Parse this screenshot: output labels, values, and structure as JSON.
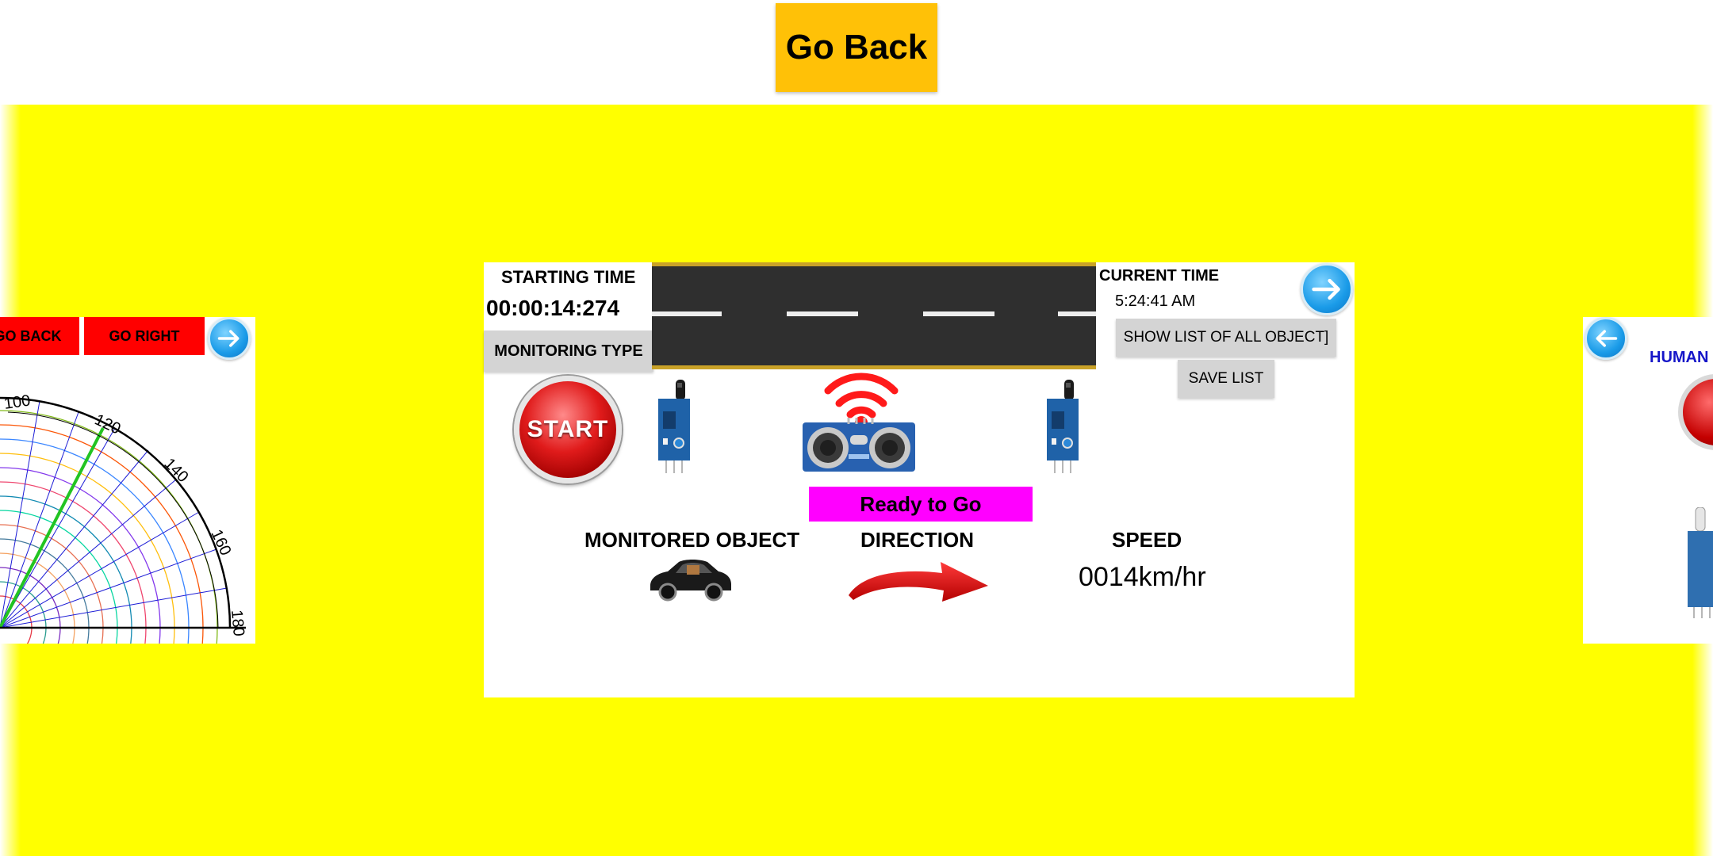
{
  "top": {
    "go_back_label": "Go Back"
  },
  "left_card": {
    "back_label": "GO BACK",
    "right_label": "GO RIGHT",
    "angle_labels": [
      "100",
      "120",
      "140",
      "160",
      "180"
    ]
  },
  "main": {
    "starting_time_label": "STARTING TIME",
    "starting_time_value": "00:00:14:274",
    "monitoring_type_label": "MONITORING TYPE",
    "start_label": "START",
    "current_time_label": "CURRENT TIME",
    "current_time_value": "5:24:41 AM",
    "show_list_label": "SHOW LIST OF ALL OBJECT]",
    "save_list_label": "SAVE LIST",
    "status_text": "Ready to Go",
    "monitored_object_label": "MONITORED OBJECT",
    "direction_label": "DIRECTION",
    "speed_label": "SPEED",
    "speed_value": "0014km/hr"
  },
  "right_card": {
    "title": "HUMAN"
  },
  "colors": {
    "background_yellow": "#ffff00",
    "go_back_button": "#ffc107",
    "red_button": "#ff0000",
    "status_magenta": "#ff00ff",
    "grey_button": "#d4d4d4",
    "arrow_blue": "#1a9be8"
  },
  "icons": [
    "arrow-right-circle-icon",
    "arrow-left-circle-icon",
    "wifi-icon",
    "car-icon",
    "direction-arrow-icon",
    "ir-sensor-icon",
    "ultrasonic-sensor-icon"
  ]
}
